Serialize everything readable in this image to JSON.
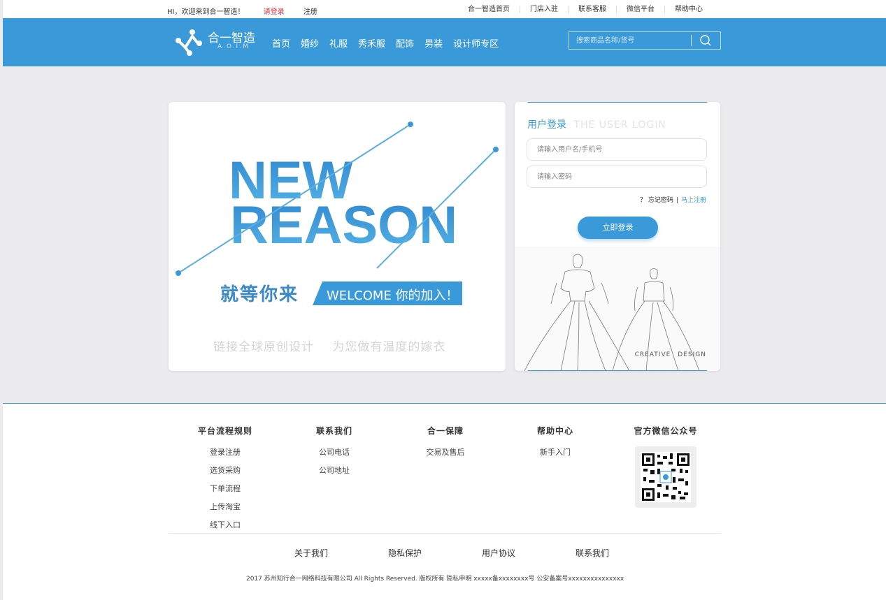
{
  "topbar": {
    "greeting": "HI，欢迎来到合一智造！",
    "login": "请登录",
    "register": "注册",
    "links": [
      "合一智造首页",
      "门店入驻",
      "联系客服",
      "微信平台",
      "帮助中心"
    ]
  },
  "header": {
    "logo_text": "合一智造",
    "logo_sub": "A.O.I.M",
    "nav": [
      "首页",
      "婚纱",
      "礼服",
      "秀禾服",
      "配饰",
      "男装",
      "设计师专区"
    ],
    "search_placeholder": "搜索商品名称/货号"
  },
  "banner": {
    "headline_1": "NEW",
    "headline_2": "REASON",
    "slogan": "就等你来",
    "welcome": "WELCOME 你的加入！",
    "tagline_1": "链接全球原创设计",
    "tagline_2": "为您做有温度的嫁衣"
  },
  "login": {
    "title": "用户登录",
    "title_en": "THE USER LOGIN",
    "username_placeholder": "请输入用户名/手机号",
    "password_placeholder": "请输入密码",
    "forgot": "？ 忘记密码",
    "separator": "|",
    "register_now": "马上注册",
    "submit": "立即登录",
    "creative": "CREATIVE",
    "design": "DESIGN"
  },
  "footer": {
    "columns": [
      {
        "title": "平台流程规则",
        "items": [
          "登录注册",
          "选货采购",
          "下单流程",
          "上传淘宝",
          "线下入口"
        ]
      },
      {
        "title": "联系我们",
        "items": [
          "公司电话",
          "公司地址"
        ]
      },
      {
        "title": "合一保障",
        "items": [
          "交易及售后"
        ]
      },
      {
        "title": "帮助中心",
        "items": [
          "新手入门"
        ]
      },
      {
        "title": "官方微信公众号",
        "items": []
      }
    ],
    "links": [
      "关于我们",
      "隐私保护",
      "用户协议",
      "联系我们"
    ],
    "copyright": "2017 苏州知行合一网络科技有限公司 All Rights Reserved.  版权所有 隐私申明   xxxxx备xxxxxxxx号   公安备案号xxxxxxxxxxxxxxx"
  },
  "colors": {
    "brand": "#3a9ad9",
    "login_link": "#d8313d"
  }
}
